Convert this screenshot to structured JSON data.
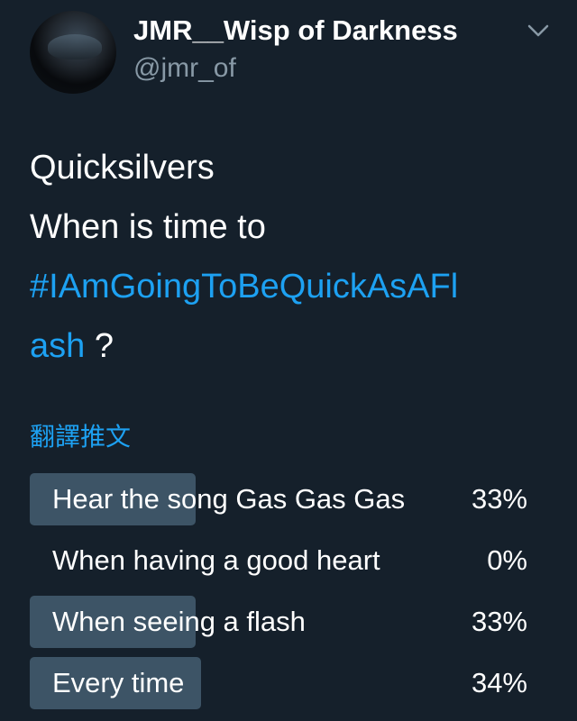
{
  "author": {
    "display_name": "JMR__Wisp of Darkness",
    "handle": "@jmr_of"
  },
  "tweet": {
    "line1": "Quicksilvers",
    "line2": "When is time to",
    "hashtag_part1": "#IAmGoingToBeQuickAsAFl",
    "hashtag_part2": "ash",
    "suffix": " ?",
    "translate_label": "翻譯推文"
  },
  "poll": {
    "options": [
      {
        "label": "Hear the song Gas Gas Gas",
        "percent_label": "33%",
        "percent": 33
      },
      {
        "label": "When having a good heart",
        "percent_label": "0%",
        "percent": 0
      },
      {
        "label": "When seeing a flash",
        "percent_label": "33%",
        "percent": 33
      },
      {
        "label": "Every time",
        "percent_label": "34%",
        "percent": 34
      }
    ]
  },
  "colors": {
    "background": "#15202b",
    "link": "#1da1f2",
    "secondary_text": "#8899a6",
    "poll_bar": "#3d5466"
  },
  "icons": {
    "menu_caret": "chevron-down-icon",
    "avatar": "avatar"
  }
}
